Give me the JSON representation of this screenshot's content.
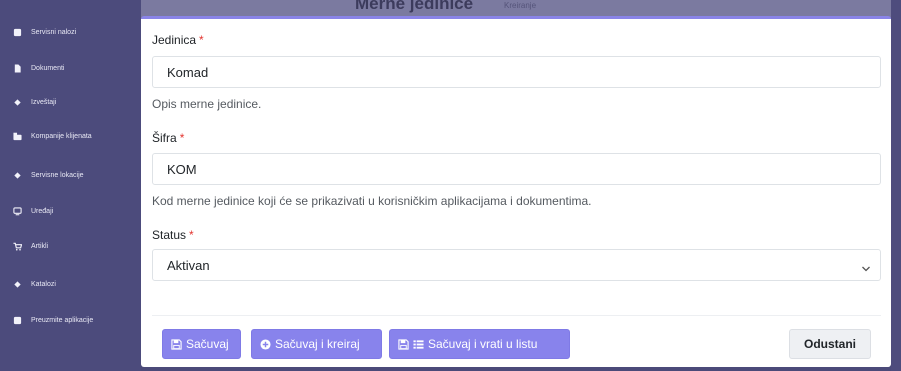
{
  "background": {
    "title": "Merne jedinice",
    "subtitle": "Kreiranje",
    "sidebar_items": [
      {
        "label": "Servisni nalozi",
        "icon": "square-icon"
      },
      {
        "label": "Dokumenti",
        "icon": "document-icon"
      },
      {
        "label": "Izveštaji",
        "icon": "diamond-icon"
      },
      {
        "label": "Kompanije klijenata",
        "icon": "briefcase-icon"
      },
      {
        "label": "Servisne lokacije",
        "icon": "diamond-icon"
      },
      {
        "label": "Uređaji",
        "icon": "monitor-icon"
      },
      {
        "label": "Artikli",
        "icon": "cart-icon"
      },
      {
        "label": "Katalozi",
        "icon": "diamond-icon"
      },
      {
        "label": "Preuzmite aplikacije",
        "icon": "square-icon"
      }
    ]
  },
  "form": {
    "unit": {
      "label": "Jedinica",
      "required_mark": "*",
      "value": "Komad",
      "help": "Opis merne jedinice."
    },
    "code": {
      "label": "Šifra",
      "required_mark": "*",
      "value": "KOM",
      "help": "Kod merne jedinice koji će se prikazivati u korisničkim aplikacijama i dokumentima."
    },
    "status": {
      "label": "Status",
      "required_mark": "*",
      "value": "Aktivan"
    }
  },
  "actions": {
    "save": "Sačuvaj",
    "save_create": "Sačuvaj i kreiraj",
    "save_return": "Sačuvaj i vrati u listu",
    "cancel": "Odustani"
  },
  "colors": {
    "accent": "#8883ec",
    "required": "#e3342f",
    "sidebar": "#4c4b7c"
  }
}
